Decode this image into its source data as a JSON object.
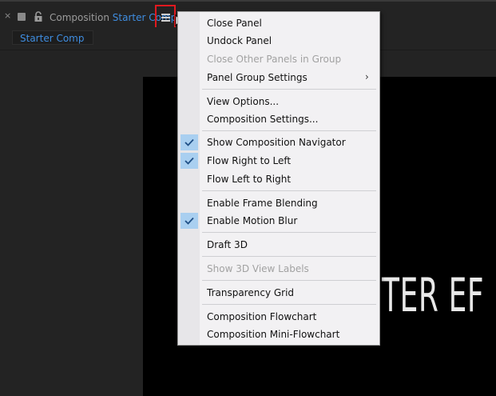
{
  "panel": {
    "close_glyph": "×",
    "title_prefix": "Composition",
    "comp_name": "Starter Comp",
    "comp_tab_label": "Starter Comp",
    "viewer_text": "TER EF"
  },
  "menu": {
    "items": [
      {
        "label": "Close Panel",
        "enabled": true,
        "checked": false
      },
      {
        "label": "Undock Panel",
        "enabled": true,
        "checked": false
      },
      {
        "label": "Close Other Panels in Group",
        "enabled": false,
        "checked": false
      },
      {
        "label": "Panel Group Settings",
        "enabled": true,
        "checked": false,
        "submenu_glyph": "›"
      },
      {
        "label": "View Options...",
        "enabled": true,
        "checked": false
      },
      {
        "label": "Composition Settings...",
        "enabled": true,
        "checked": false
      },
      {
        "label": "Show Composition Navigator",
        "enabled": true,
        "checked": true
      },
      {
        "label": "Flow Right to Left",
        "enabled": true,
        "checked": true
      },
      {
        "label": "Flow Left to Right",
        "enabled": true,
        "checked": false
      },
      {
        "label": "Enable Frame Blending",
        "enabled": true,
        "checked": false
      },
      {
        "label": "Enable Motion Blur",
        "enabled": true,
        "checked": true
      },
      {
        "label": "Draft 3D",
        "enabled": true,
        "checked": false
      },
      {
        "label": "Show 3D View Labels",
        "enabled": false,
        "checked": false
      },
      {
        "label": "Transparency Grid",
        "enabled": true,
        "checked": false
      },
      {
        "label": "Composition Flowchart",
        "enabled": true,
        "checked": false
      },
      {
        "label": "Composition Mini-Flowchart",
        "enabled": true,
        "checked": false
      }
    ]
  },
  "colors": {
    "accent_blue": "#3f8de0",
    "highlight_red": "#e0191f",
    "check_bg": "#a9cff0"
  }
}
